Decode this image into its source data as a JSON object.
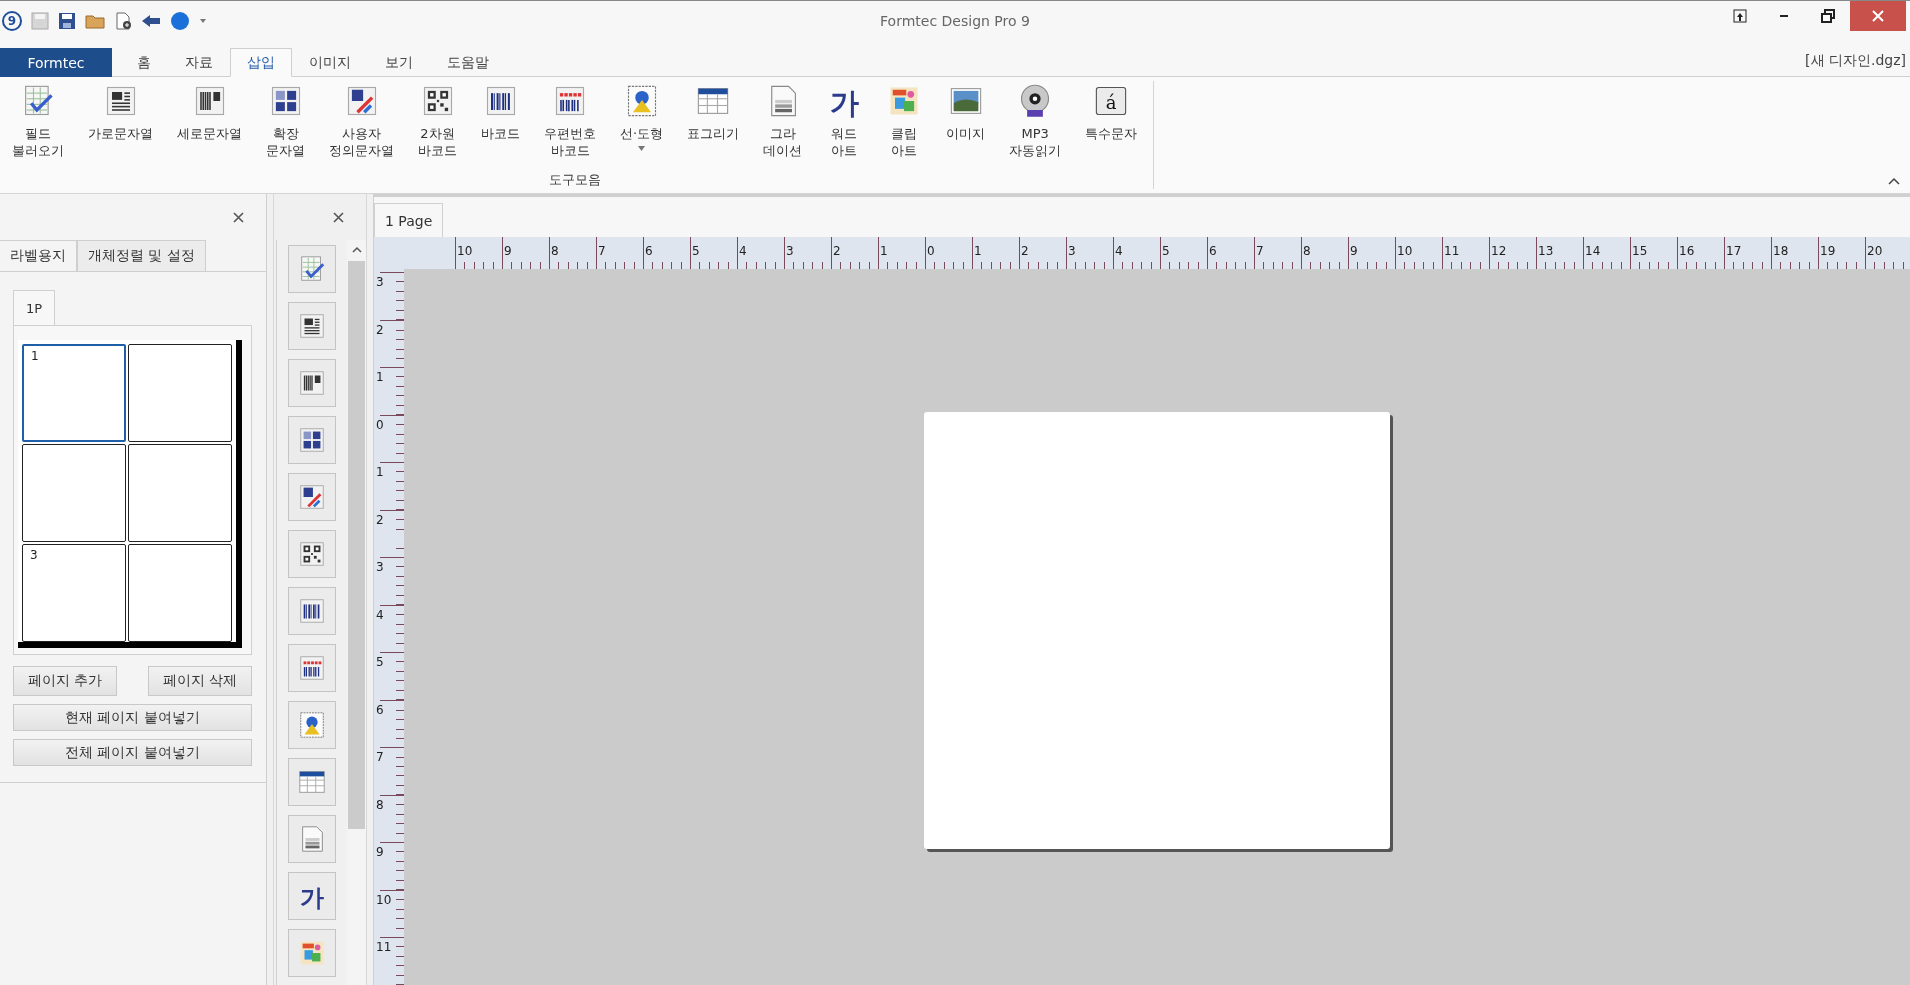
{
  "window": {
    "title": "Formtec Design Pro 9",
    "logo": "9"
  },
  "menu": {
    "app_button": "Formtec",
    "document": "[새 디자인.dgz]",
    "tabs": [
      {
        "label": "홈",
        "selected": false
      },
      {
        "label": "자료",
        "selected": false
      },
      {
        "label": "삽입",
        "selected": true
      },
      {
        "label": "이미지",
        "selected": false
      },
      {
        "label": "보기",
        "selected": false
      },
      {
        "label": "도움말",
        "selected": false
      }
    ]
  },
  "ribbon": {
    "group_label": "도구모음",
    "items": [
      {
        "kind": "field",
        "lines": [
          "필드",
          "불러오기"
        ]
      },
      {
        "kind": "hstring",
        "lines": [
          "가로문자열"
        ]
      },
      {
        "kind": "vstring",
        "lines": [
          "세로문자열"
        ]
      },
      {
        "kind": "extstring",
        "lines": [
          "확장",
          "문자열"
        ]
      },
      {
        "kind": "custom",
        "lines": [
          "사용자",
          "정의문자열"
        ]
      },
      {
        "kind": "qr",
        "lines": [
          "2차원",
          "바코드"
        ]
      },
      {
        "kind": "barcode",
        "lines": [
          "바코드"
        ]
      },
      {
        "kind": "postal",
        "lines": [
          "우편번호",
          "바코드"
        ]
      },
      {
        "kind": "shape",
        "lines": [
          "선·도형"
        ],
        "dropdown": true
      },
      {
        "kind": "table",
        "lines": [
          "표그리기"
        ]
      },
      {
        "kind": "gradation",
        "lines": [
          "그라",
          "데이션"
        ]
      },
      {
        "kind": "wordart",
        "glyph": "가",
        "lines": [
          "워드",
          "아트"
        ]
      },
      {
        "kind": "clipart",
        "lines": [
          "클립",
          "아트"
        ]
      },
      {
        "kind": "image",
        "lines": [
          "이미지"
        ]
      },
      {
        "kind": "mp3",
        "lines": [
          "MP3",
          "자동읽기"
        ]
      },
      {
        "kind": "special",
        "glyph": "á",
        "lines": [
          "특수문자"
        ]
      }
    ]
  },
  "left_panel": {
    "tabs": [
      {
        "label": "라벨용지",
        "selected": true
      },
      {
        "label": "개체정렬 및 설정",
        "selected": false
      }
    ],
    "page_tabs": [
      {
        "label": "1P",
        "selected": true
      }
    ],
    "cells": [
      {
        "number": "1",
        "selected": true
      },
      {
        "selected": false
      },
      {
        "selected": false
      },
      {
        "selected": false
      },
      {
        "number": "3",
        "selected": false
      },
      {
        "selected": false
      }
    ],
    "row_buttons": [
      "페이지 추가",
      "페이지 삭제"
    ],
    "buttons": [
      "현재 페이지 붙여넣기",
      "전체 페이지 붙여넣기"
    ]
  },
  "toolbox": {
    "items": [
      {
        "kind": "field"
      },
      {
        "kind": "hstring"
      },
      {
        "kind": "vstring"
      },
      {
        "kind": "extstring"
      },
      {
        "kind": "custom"
      },
      {
        "kind": "qr"
      },
      {
        "kind": "barcode"
      },
      {
        "kind": "postal"
      },
      {
        "kind": "shape"
      },
      {
        "kind": "table"
      },
      {
        "kind": "gradation"
      },
      {
        "kind": "wordart",
        "glyph": "가"
      },
      {
        "kind": "clipart"
      }
    ]
  },
  "canvas": {
    "tabs": [
      {
        "label": "1 Page",
        "selected": true
      }
    ],
    "ruler_h": [
      "10",
      "9",
      "8",
      "7",
      "6",
      "5",
      "4",
      "3",
      "2",
      "1",
      "0",
      "1",
      "2",
      "3",
      "4",
      "5",
      "6",
      "7",
      "8",
      "9",
      "10",
      "11",
      "12",
      "13",
      "14",
      "15",
      "16",
      "17",
      "18",
      "19",
      "20"
    ],
    "ruler_v": [
      "3",
      "2",
      "1",
      "0",
      "1",
      "2",
      "3",
      "4",
      "5",
      "6",
      "7",
      "8",
      "9",
      "10",
      "11"
    ]
  }
}
